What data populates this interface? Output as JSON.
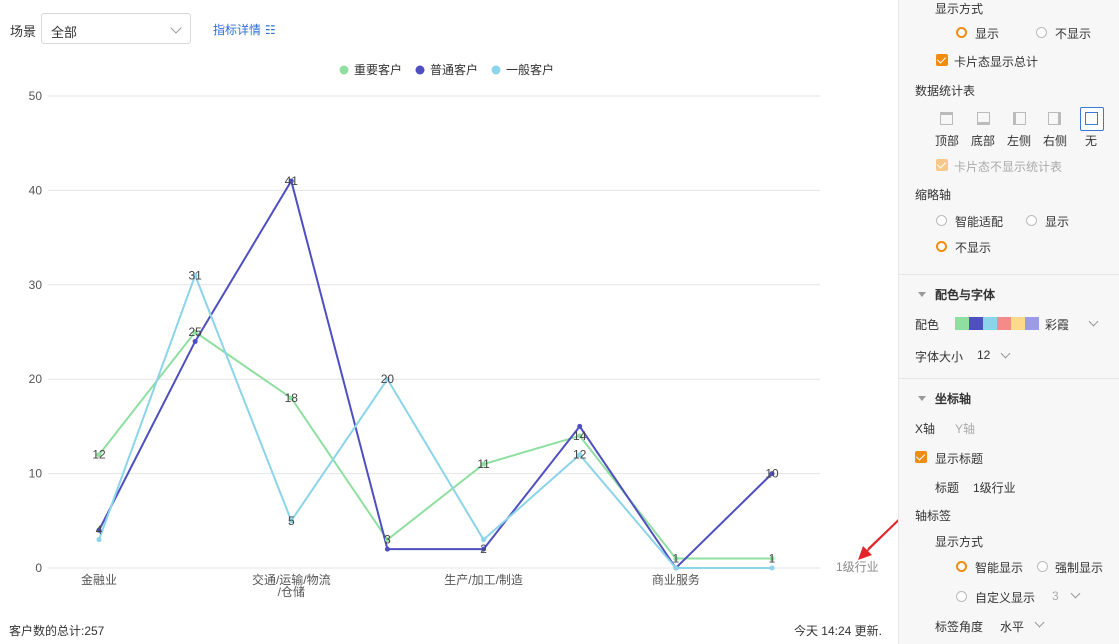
{
  "toolbar": {
    "scene_label": "场景",
    "scene_value": "全部",
    "metric_link": "指标详情",
    "metric_link_icon": "list-icon"
  },
  "footer": {
    "total": "客户数的总计:257",
    "updated": "今天 14:24 更新."
  },
  "chart_data": {
    "type": "line",
    "categories": [
      "金融业",
      "",
      "交通/运输/物流/仓储",
      "",
      "生产/加工/制造",
      "",
      "商业服务",
      ""
    ],
    "x_tick_labels": [
      {
        "index": 0,
        "lines": [
          "金融业"
        ]
      },
      {
        "index": 2,
        "lines": [
          "交通/运输/物流",
          "/仓储"
        ]
      },
      {
        "index": 4,
        "lines": [
          "生产/加工/制造"
        ]
      },
      {
        "index": 6,
        "lines": [
          "商业服务"
        ]
      }
    ],
    "xlabel": "1级行业",
    "ylim": [
      0,
      50
    ],
    "yticks": [
      0,
      10,
      20,
      30,
      40,
      50
    ],
    "grid": true,
    "legend_position": "top-center",
    "series": [
      {
        "name": "重要客户",
        "color": "#8fdfa0",
        "values": [
          12,
          25,
          18,
          3,
          11,
          14,
          1,
          1
        ]
      },
      {
        "name": "普通客户",
        "color": "#4e4fc0",
        "values": [
          4,
          24,
          41,
          2,
          2,
          15,
          0,
          10
        ]
      },
      {
        "name": "一般客户",
        "color": "#8cd4ea",
        "values": [
          3,
          31,
          5,
          20,
          3,
          12,
          0,
          0
        ]
      }
    ],
    "data_labels": [
      {
        "series": 0,
        "index": 0,
        "text": "12"
      },
      {
        "series": 0,
        "index": 1,
        "text": "25"
      },
      {
        "series": 0,
        "index": 2,
        "text": "18"
      },
      {
        "series": 0,
        "index": 3,
        "text": "3"
      },
      {
        "series": 0,
        "index": 4,
        "text": "11"
      },
      {
        "series": 0,
        "index": 5,
        "text": "14"
      },
      {
        "series": 0,
        "index": 6,
        "text": "1"
      },
      {
        "series": 0,
        "index": 7,
        "text": "1"
      },
      {
        "series": 1,
        "index": 0,
        "text": "4"
      },
      {
        "series": 1,
        "index": 2,
        "text": "41"
      },
      {
        "series": 1,
        "index": 4,
        "text": "2"
      },
      {
        "series": 1,
        "index": 7,
        "text": "10"
      },
      {
        "series": 2,
        "index": 1,
        "text": "31"
      },
      {
        "series": 2,
        "index": 2,
        "text": "5"
      },
      {
        "series": 2,
        "index": 3,
        "text": "20"
      },
      {
        "series": 2,
        "index": 5,
        "text": "12"
      }
    ]
  },
  "panel": {
    "display_mode_title": "显示方式",
    "display_options": [
      "显示",
      "不显示"
    ],
    "display_selected": 0,
    "card_total_label": "卡片态显示总计",
    "stats_table_title": "数据统计表",
    "stats_positions": [
      "顶部",
      "底部",
      "左侧",
      "右侧",
      "无"
    ],
    "stats_selected": 4,
    "card_hide_stats_label": "卡片态不显示统计表",
    "thumbnail_axis_title": "缩略轴",
    "thumbnail_options": [
      "智能适配",
      "显示",
      "不显示"
    ],
    "thumbnail_selected": 2,
    "color_font_title": "配色与字体",
    "color_label": "配色",
    "color_scheme_name": "彩霞",
    "color_swatches": [
      "#8fdfa0",
      "#4e4fc0",
      "#8cd4ea",
      "#f58a8a",
      "#ffd98a",
      "#9b9be8"
    ],
    "font_size_label": "字体大小",
    "font_size_value": "12",
    "axis_title": "坐标轴",
    "axis_tabs": [
      "X轴",
      "Y轴"
    ],
    "show_title_label": "显示标题",
    "title_label": "标题",
    "title_value": "1级行业",
    "axis_labels_title": "轴标签",
    "axis_display_mode_title": "显示方式",
    "axis_display_options": [
      "智能显示",
      "强制显示",
      "自定义显示"
    ],
    "axis_display_selected": 0,
    "custom_value": "3",
    "label_angle_label": "标签角度",
    "label_angle_value": "水平"
  }
}
